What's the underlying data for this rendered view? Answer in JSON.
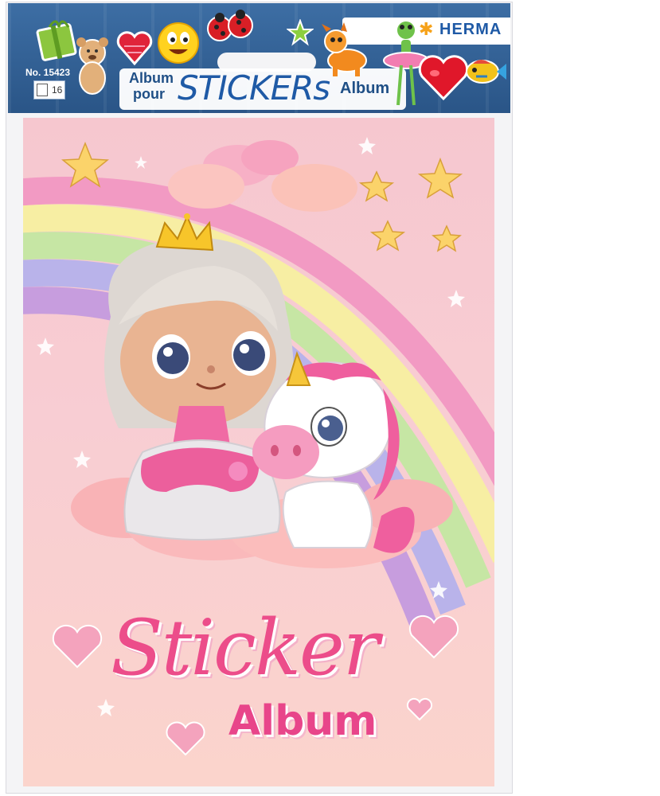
{
  "package": {
    "brand": "HERMA",
    "article_number": "No. 15423",
    "page_count": "16",
    "title_left_top": "Album",
    "title_left_bottom": "pour",
    "title_main": "STICKERs",
    "title_right": "Album"
  },
  "cover": {
    "title_script": "Sticker",
    "title_bold": "Album"
  },
  "colors": {
    "header_blue": "#2f5f96",
    "brand_blue": "#1f5aa6",
    "title_pink": "#ec4d8a",
    "cover_pink": "#f7c9d0"
  },
  "icons": [
    "gift-sticker-icon",
    "teddy-bear-sticker-icon",
    "heart-sticker-icon",
    "smiley-sticker-icon",
    "ladybug-sticker-icon",
    "star-sticker-icon",
    "dog-sticker-icon",
    "frog-ballerina-sticker-icon",
    "heart-balloon-sticker-icon",
    "fish-sticker-icon",
    "brand-star-icon",
    "page-icon"
  ]
}
